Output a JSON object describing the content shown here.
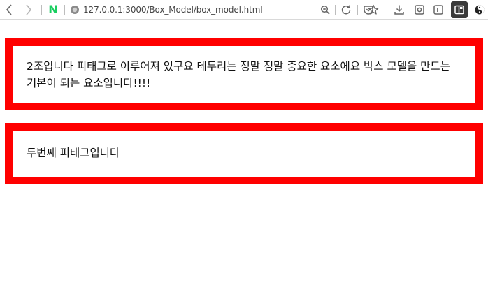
{
  "browser": {
    "url": "127.0.0.1:3000/Box_Model/box_model.html",
    "naver_label": "N",
    "icons": {
      "back": "chevron-left-icon",
      "forward": "chevron-right-icon",
      "site_info": "site-info-icon",
      "zoom": "zoom-icon",
      "reload": "reload-icon",
      "pocket": "shield-heart-icon",
      "bookmark": "star-icon",
      "download": "download-icon",
      "screenshot": "screenshot-icon",
      "reader": "reader-icon",
      "sidebar": "sidebar-icon",
      "profile": "profile-icon"
    }
  },
  "page": {
    "box1_text": "2조입니다 피태그로 이루어져 있구요 테두리는 정말 정말 중요한 요소에요 박스 모델을 만드는 기본이 되는 요소입니다!!!!",
    "box2_text": "두번째 피태그입니다",
    "border_color": "#ff0000"
  }
}
